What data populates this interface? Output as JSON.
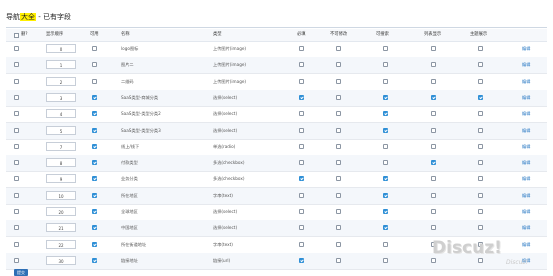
{
  "page": {
    "title_prefix": "导航",
    "title_highlight": "大全",
    "title_suffix": " - 已有字段"
  },
  "columns": {
    "delete": "删?",
    "order": "显示顺序",
    "enabled": "可用",
    "name": "名称",
    "type": "类型",
    "required": "必填",
    "unchangeable": "不可修改",
    "searchable": "可搜索",
    "in_list": "列表显示",
    "sortable": "主题展示",
    "action": "编辑"
  },
  "rows": [
    {
      "order": "0",
      "name": "logo图标",
      "type": "上传图片(image)",
      "enabled": false,
      "required": false,
      "unchangeable": false,
      "searchable": false,
      "in_list": false,
      "sortable": false
    },
    {
      "order": "1",
      "name": "图片二",
      "type": "上传图片(image)",
      "enabled": false,
      "required": false,
      "unchangeable": false,
      "searchable": false,
      "in_list": false,
      "sortable": false
    },
    {
      "order": "2",
      "name": "二维码",
      "type": "上传图片(image)",
      "enabled": false,
      "required": false,
      "unchangeable": false,
      "searchable": false,
      "in_list": false,
      "sortable": false
    },
    {
      "order": "3",
      "name": "SaaS类型-商城分类",
      "type": "选择(select)",
      "enabled": true,
      "required": true,
      "unchangeable": false,
      "searchable": true,
      "in_list": true,
      "sortable": true
    },
    {
      "order": "4",
      "name": "SaaS类型-类型分类2",
      "type": "选择(select)",
      "enabled": true,
      "required": false,
      "unchangeable": false,
      "searchable": true,
      "in_list": false,
      "sortable": false
    },
    {
      "order": "5",
      "name": "SaaS类型-类型分类3",
      "type": "选择(select)",
      "enabled": true,
      "required": false,
      "unchangeable": false,
      "searchable": true,
      "in_list": false,
      "sortable": false
    },
    {
      "order": "7",
      "name": "线上/线下",
      "type": "单选(radio)",
      "enabled": true,
      "required": false,
      "unchangeable": false,
      "searchable": false,
      "in_list": false,
      "sortable": false
    },
    {
      "order": "8",
      "name": "付款类型",
      "type": "多选(checkbox)",
      "enabled": true,
      "required": false,
      "unchangeable": false,
      "searchable": false,
      "in_list": true,
      "sortable": false
    },
    {
      "order": "9",
      "name": "业务分类",
      "type": "多选(checkbox)",
      "enabled": true,
      "required": true,
      "unchangeable": false,
      "searchable": true,
      "in_list": false,
      "sortable": false
    },
    {
      "order": "10",
      "name": "所在地区",
      "type": "字串(text)",
      "enabled": true,
      "required": false,
      "unchangeable": false,
      "searchable": true,
      "in_list": false,
      "sortable": false
    },
    {
      "order": "20",
      "name": "全球地区",
      "type": "选择(select)",
      "enabled": true,
      "required": false,
      "unchangeable": false,
      "searchable": true,
      "in_list": false,
      "sortable": false
    },
    {
      "order": "21",
      "name": "中国地区",
      "type": "选择(select)",
      "enabled": true,
      "required": false,
      "unchangeable": false,
      "searchable": true,
      "in_list": false,
      "sortable": false
    },
    {
      "order": "22",
      "name": "所在街道地址",
      "type": "字串(text)",
      "enabled": true,
      "required": false,
      "unchangeable": false,
      "searchable": false,
      "in_list": false,
      "sortable": false
    },
    {
      "order": "30",
      "name": "链接地址",
      "type": "链接(url)",
      "enabled": true,
      "required": true,
      "unchangeable": false,
      "searchable": false,
      "in_list": false,
      "sortable": false
    }
  ],
  "submit_label": "提交",
  "watermark": {
    "main": "Discuz!",
    "sub": "Discuz!"
  },
  "colors": {
    "accent": "#2e8fd6",
    "link": "#2a79c4",
    "highlight": "#ffef00"
  }
}
